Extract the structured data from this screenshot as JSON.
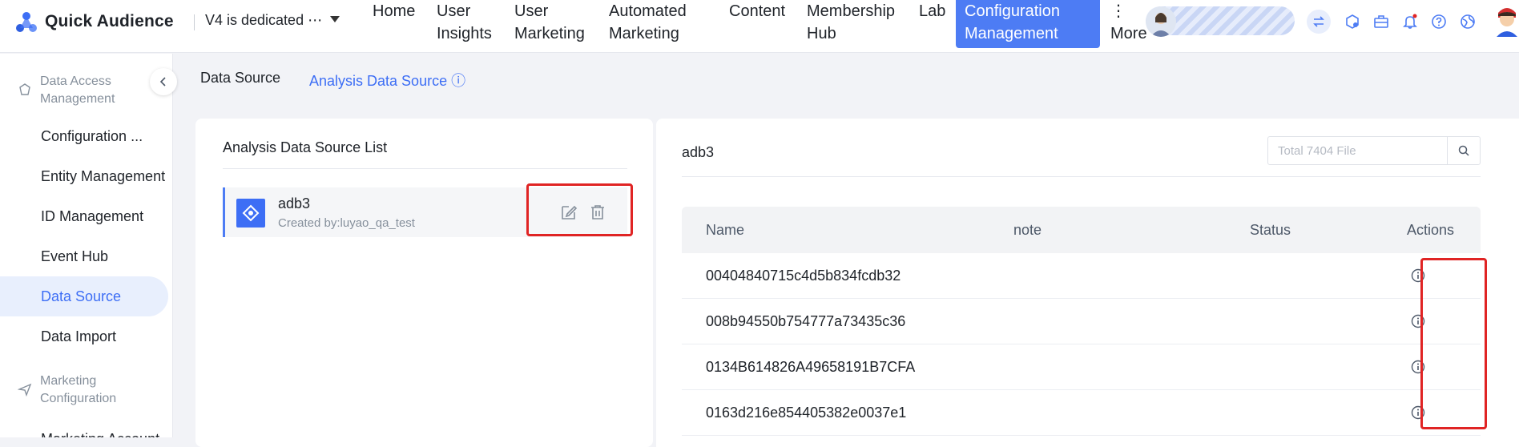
{
  "app": {
    "brand": "Quick Audience",
    "workspace": "V4 is dedicated ⋯"
  },
  "nav": {
    "items": [
      {
        "l1": "Home",
        "l2": ""
      },
      {
        "l1": "User",
        "l2": "Insights"
      },
      {
        "l1": "User",
        "l2": "Marketing"
      },
      {
        "l1": "Automated",
        "l2": "Marketing"
      },
      {
        "l1": "Content",
        "l2": ""
      },
      {
        "l1": "Membership",
        "l2": "Hub"
      },
      {
        "l1": "Lab",
        "l2": ""
      },
      {
        "l1": "Configuration",
        "l2": "Management"
      }
    ],
    "more_dots": "⋮",
    "more_label": "More"
  },
  "sidebar": {
    "group1": "Data Access Management",
    "items": [
      "Configuration ...",
      "Entity Management",
      "ID Management",
      "Event Hub",
      "Data Source",
      "Data Import"
    ],
    "group2": "Marketing Configuration",
    "item_cut": "Marketing Account"
  },
  "tabs": {
    "data_source": "Data Source",
    "analysis": "Analysis Data Source ⓘ"
  },
  "left_panel": {
    "title": "Analysis Data Source List",
    "card": {
      "name": "adb3",
      "created_by": "Created by:luyao_qa_test"
    }
  },
  "right_panel": {
    "title": "adb3",
    "search_placeholder": "Total 7404 File",
    "columns": {
      "name": "Name",
      "note": "note",
      "status": "Status",
      "actions": "Actions"
    },
    "rows": [
      {
        "name": "00404840715c4d5b834fcdb32"
      },
      {
        "name": "008b94550b754777a73435c36"
      },
      {
        "name": "0134B614826A49658191B7CFA"
      },
      {
        "name": "0163d216e854405382e0037e1"
      }
    ]
  },
  "colors": {
    "accent": "#4d7cf4",
    "highlight": "#e02424",
    "active_text": "#3d6ef5"
  }
}
